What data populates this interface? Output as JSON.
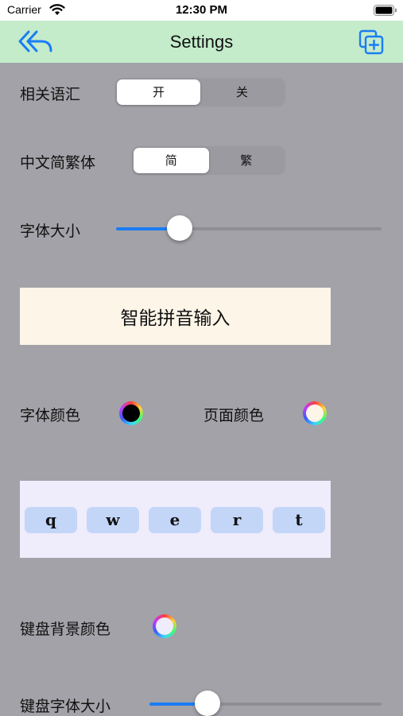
{
  "status_bar": {
    "carrier": "Carrier",
    "time": "12:30 PM"
  },
  "nav": {
    "title": "Settings",
    "back_icon": "back-arrow-icon",
    "add_icon": "add-page-icon"
  },
  "related_words": {
    "label": "相关语汇",
    "options": [
      "开",
      "关"
    ],
    "selected": "开"
  },
  "script_variant": {
    "label": "中文简繁体",
    "options": [
      "简",
      "繁"
    ],
    "selected": "简"
  },
  "font_size": {
    "label": "字体大小",
    "value_fraction": 0.24
  },
  "preview": {
    "text": "智能拼音输入"
  },
  "font_color": {
    "label": "字体颜色",
    "value": "#000000"
  },
  "page_color": {
    "label": "页面颜色",
    "value": "#fdf5e8"
  },
  "keyboard_preview": {
    "keys": [
      "q",
      "w",
      "e",
      "r",
      "t"
    ]
  },
  "keyboard_bg_color": {
    "label": "键盘背景颜色",
    "value": "#efecfb"
  },
  "keyboard_font_size": {
    "label": "键盘字体大小",
    "value_fraction": 0.25
  },
  "colors": {
    "accent": "#1a7cf5",
    "nav_bg": "#c4eccb",
    "page_bg": "#a3a2a8",
    "key_bg": "#c3d6f8"
  }
}
